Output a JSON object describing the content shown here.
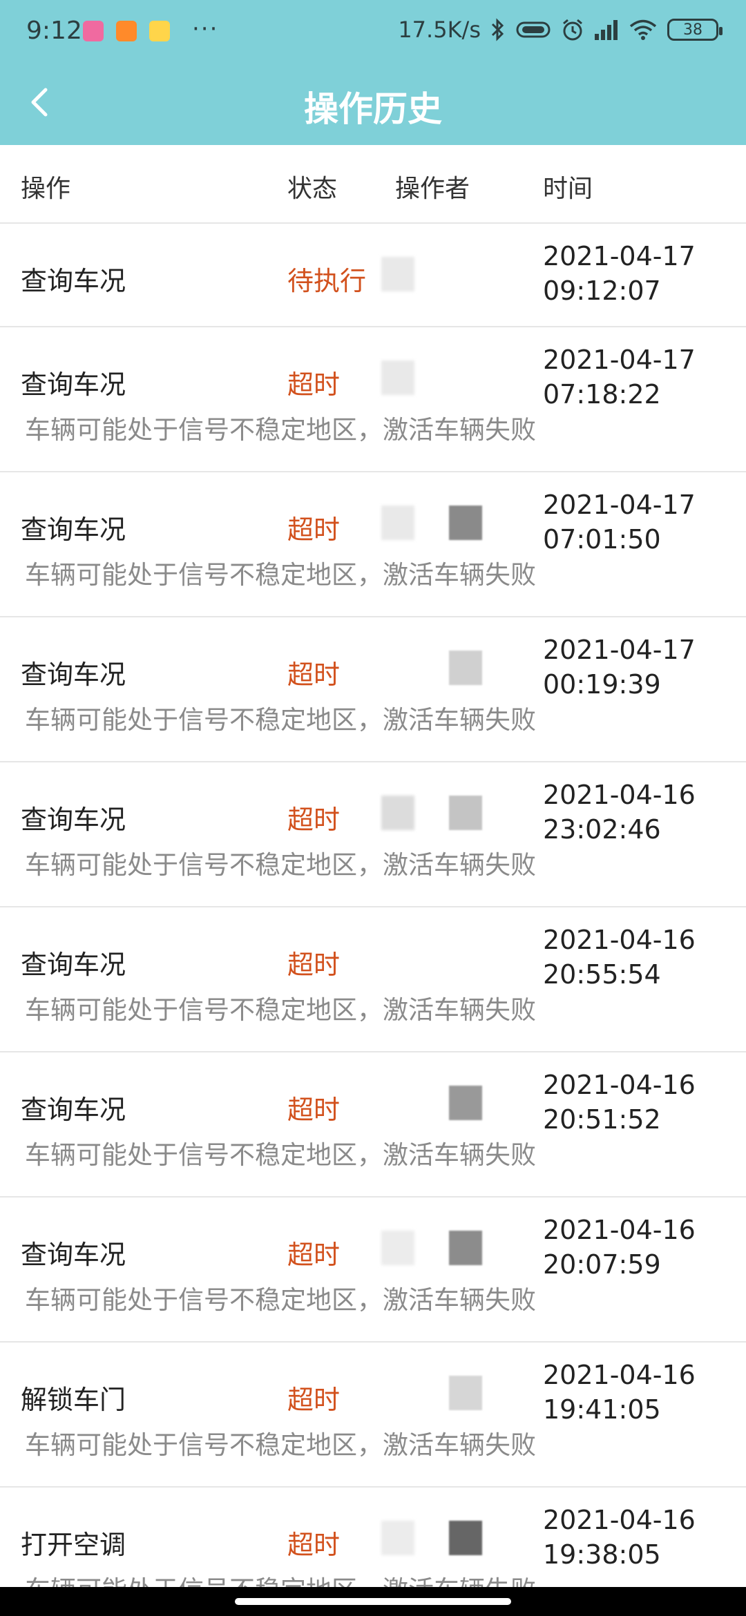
{
  "status_bar": {
    "time": "9:12",
    "dots": "···",
    "net_speed": "17.5K/s",
    "battery": "38",
    "icons": [
      "bluetooth-icon",
      "vibrate-icon",
      "alarm-icon",
      "signal-icon",
      "wifi-icon"
    ]
  },
  "header": {
    "title": "操作历史",
    "back_icon": "chevron-left-icon",
    "accent": "#7fd0d8"
  },
  "columns": {
    "operation": "操作",
    "status": "状态",
    "operator": "操作者",
    "time": "时间"
  },
  "rows": [
    {
      "op": "查询车况",
      "status": "待执行",
      "date": "2021-04-17",
      "time": "09:12:07",
      "message": ""
    },
    {
      "op": "查询车况",
      "status": "超时",
      "date": "2021-04-17",
      "time": "07:18:22",
      "message": "车辆可能处于信号不稳定地区，激活车辆失败"
    },
    {
      "op": "查询车况",
      "status": "超时",
      "date": "2021-04-17",
      "time": "07:01:50",
      "message": "车辆可能处于信号不稳定地区，激活车辆失败"
    },
    {
      "op": "查询车况",
      "status": "超时",
      "date": "2021-04-17",
      "time": "00:19:39",
      "message": "车辆可能处于信号不稳定地区，激活车辆失败"
    },
    {
      "op": "查询车况",
      "status": "超时",
      "date": "2021-04-16",
      "time": "23:02:46",
      "message": "车辆可能处于信号不稳定地区，激活车辆失败"
    },
    {
      "op": "查询车况",
      "status": "超时",
      "date": "2021-04-16",
      "time": "20:55:54",
      "message": "车辆可能处于信号不稳定地区，激活车辆失败"
    },
    {
      "op": "查询车况",
      "status": "超时",
      "date": "2021-04-16",
      "time": "20:51:52",
      "message": "车辆可能处于信号不稳定地区，激活车辆失败"
    },
    {
      "op": "查询车况",
      "status": "超时",
      "date": "2021-04-16",
      "time": "20:07:59",
      "message": "车辆可能处于信号不稳定地区，激活车辆失败"
    },
    {
      "op": "解锁车门",
      "status": "超时",
      "date": "2021-04-16",
      "time": "19:41:05",
      "message": "车辆可能处于信号不稳定地区，激活车辆失败"
    },
    {
      "op": "打开空调",
      "status": "超时",
      "date": "2021-04-16",
      "time": "19:38:05",
      "message": "车辆可能处于信号不稳定地区，激活车辆失败"
    }
  ],
  "colors": {
    "status_text": "#d2511d",
    "message_text": "#8a8a8a"
  }
}
